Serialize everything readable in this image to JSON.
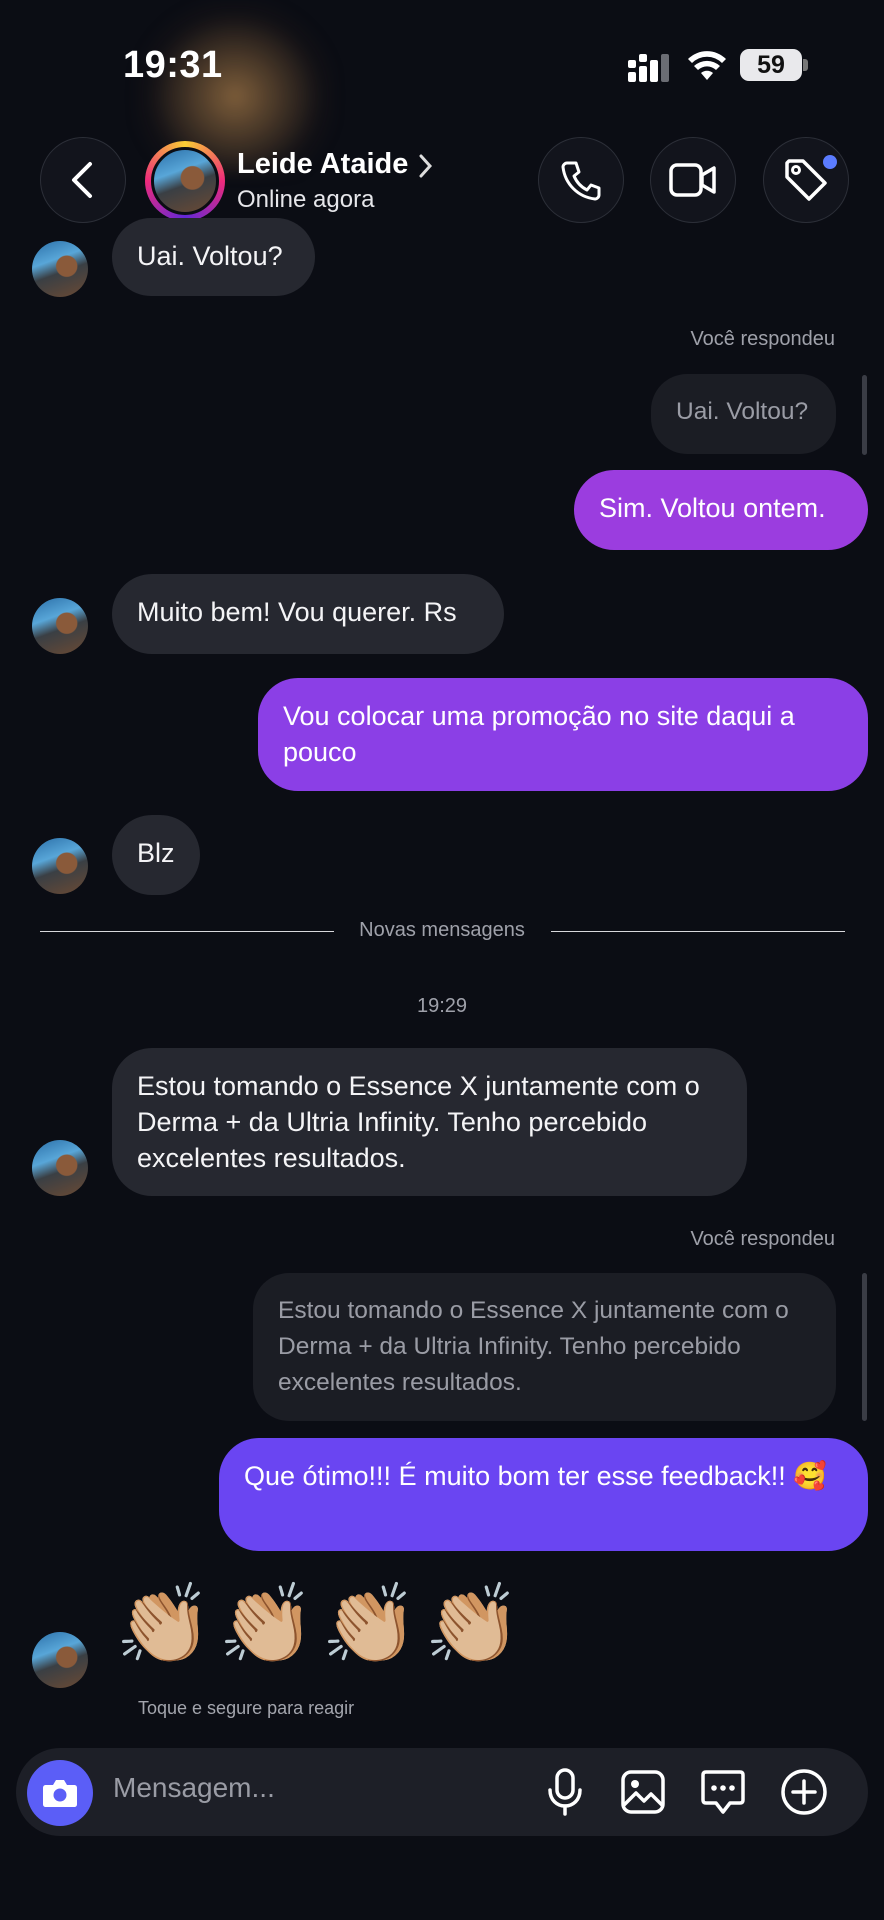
{
  "status_bar": {
    "time": "19:31",
    "battery": "59"
  },
  "header": {
    "contact_name": "Leide Ataide",
    "contact_status": "Online agora",
    "icons": [
      "chevron-left-icon",
      "phone-icon",
      "video-camera-icon",
      "tag-icon"
    ]
  },
  "messages": {
    "m1": "Uai. Voltou?",
    "reply_label_1": "Você respondeu",
    "quote_1": "Uai. Voltou?",
    "m2": "Sim. Voltou ontem.",
    "m3": "Muito bem! Vou querer. Rs",
    "m4": "Vou colocar uma promoção no site daqui a pouco",
    "m5": "Blz",
    "new_messages": "Novas mensagens",
    "timestamp": "19:29",
    "m6": "Estou tomando o Essence X juntamente com o Derma + da Ultria Infinity. Tenho percebido excelentes resultados.",
    "reply_label_2": "Você respondeu",
    "quote_2": "Estou tomando o Essence X juntamente com o Derma + da Ultria Infinity. Tenho percebido excelentes resultados.",
    "m7": "Que ótimo!!! É muito bom ter esse feedback!! 🥰",
    "reaction": "👏🏼👏🏼👏🏼👏🏼",
    "reaction_hint": "Toque e segure para reagir"
  },
  "composer": {
    "placeholder": "Mensagem..."
  },
  "colors": {
    "out_purple": "#9b3ddf",
    "out_violet": "#6a45f2",
    "accent_blue": "#5b5ef7"
  }
}
